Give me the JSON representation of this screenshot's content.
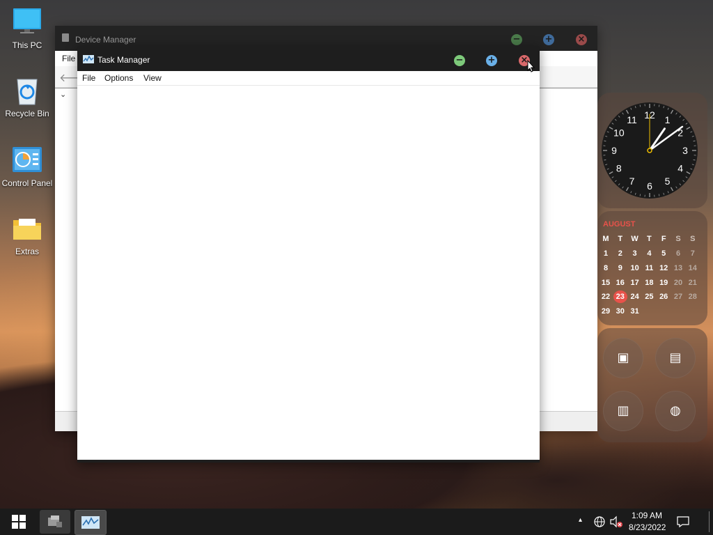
{
  "desktop": {
    "icons": [
      {
        "label": "This PC",
        "icon": "monitor-icon"
      },
      {
        "label": "Recycle Bin",
        "icon": "recycle-bin-icon"
      },
      {
        "label": "Control Panel",
        "icon": "control-panel-icon"
      },
      {
        "label": "Extras",
        "icon": "folder-icon"
      }
    ]
  },
  "device_manager": {
    "title": "Device Manager",
    "menu": {
      "file": "File"
    },
    "buttons": {
      "minimize": "minimize",
      "maximize": "maximize",
      "close": "close"
    },
    "colors": {
      "minimize": "#4a7a4a",
      "maximize": "#3f6a9a",
      "close": "#9a4a4a"
    }
  },
  "task_manager": {
    "title": "Task Manager",
    "menu": {
      "file": "File",
      "options": "Options",
      "view": "View"
    },
    "colors": {
      "minimize": "#7dc97a",
      "maximize": "#6ab0e8",
      "close": "#d9686a"
    }
  },
  "clock_widget": {
    "numbers": [
      "12",
      "1",
      "2",
      "3",
      "4",
      "5",
      "6",
      "7",
      "8",
      "9",
      "10",
      "11"
    ],
    "time": {
      "hour": 1,
      "minute": 9
    },
    "hand_color": "#ffffff",
    "second_hand_color": "#f0c000"
  },
  "calendar_widget": {
    "month": "AUGUST",
    "month_color": "#e8524a",
    "weekdays": [
      "M",
      "T",
      "W",
      "T",
      "F",
      "S",
      "S"
    ],
    "weeks": [
      [
        "1",
        "2",
        "3",
        "4",
        "5",
        "6",
        "7"
      ],
      [
        "8",
        "9",
        "10",
        "11",
        "12",
        "13",
        "14"
      ],
      [
        "15",
        "16",
        "17",
        "18",
        "19",
        "20",
        "21"
      ],
      [
        "22",
        "23",
        "24",
        "25",
        "26",
        "27",
        "28"
      ],
      [
        "29",
        "30",
        "31",
        "",
        "",
        "",
        ""
      ]
    ],
    "today": "23",
    "today_color": "#e8524a"
  },
  "quick_widget": {
    "buttons": [
      {
        "icon": "cpu-icon",
        "glyph": "▣"
      },
      {
        "icon": "memory-icon",
        "glyph": "▤"
      },
      {
        "icon": "disk-icon",
        "glyph": "▥"
      },
      {
        "icon": "globe-icon",
        "glyph": "◍"
      }
    ]
  },
  "taskbar": {
    "start_icon": "windows-start-icon",
    "apps": [
      {
        "name": "Device Manager",
        "icon": "device-manager-icon"
      },
      {
        "name": "Task Manager",
        "icon": "task-manager-icon",
        "active": true
      }
    ],
    "tray": {
      "chevron": "▴",
      "time": "1:09 AM",
      "date": "8/23/2022"
    }
  }
}
